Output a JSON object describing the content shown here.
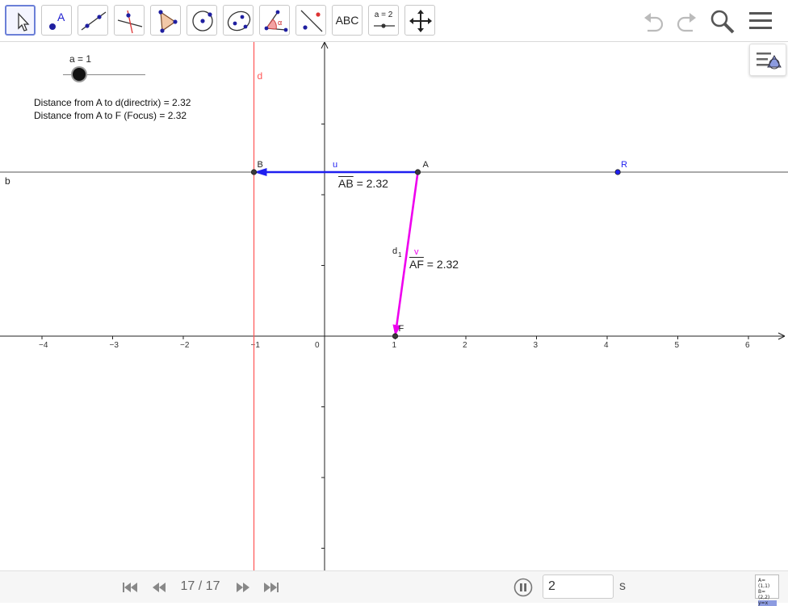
{
  "toolbar": {
    "tools": [
      {
        "name": "move-tool",
        "label": ""
      },
      {
        "name": "point-tool",
        "label": "A"
      },
      {
        "name": "line-tool",
        "label": ""
      },
      {
        "name": "perpendicular-line-tool",
        "label": ""
      },
      {
        "name": "polygon-tool",
        "label": ""
      },
      {
        "name": "circle-tool",
        "label": ""
      },
      {
        "name": "ellipse-tool",
        "label": ""
      },
      {
        "name": "angle-tool",
        "label": "α"
      },
      {
        "name": "reflect-tool",
        "label": ""
      },
      {
        "name": "text-tool",
        "label": "ABC"
      },
      {
        "name": "slider-tool",
        "label": "a = 2"
      },
      {
        "name": "move-graphics-view-tool",
        "label": ""
      }
    ],
    "right_icons": [
      "undo-icon",
      "redo-icon",
      "search-icon",
      "menu-icon"
    ]
  },
  "slider": {
    "label": "a = 1",
    "value_fraction": 0.2
  },
  "texts": {
    "distance_directrix": "Distance from A to d(directrix) = 2.32",
    "distance_focus": "Distance from A to F (Focus) = 2.32",
    "ab_value": "= 2.32",
    "ab_name": "AB",
    "af_value": "= 2.32",
    "af_name": "AF"
  },
  "labels": {
    "d": "d",
    "b": "b",
    "B": "B",
    "A": "A",
    "R": "R",
    "F": "F",
    "u": "u",
    "v": "v",
    "d1": "d",
    "d1_sub": "1"
  },
  "axes": {
    "x_ticks": [
      "−4",
      "−3",
      "−2",
      "−1",
      "0",
      "1",
      "2",
      "3",
      "4",
      "5",
      "6"
    ],
    "x_values": [
      -4,
      -3,
      -2,
      -1,
      0,
      1,
      2,
      3,
      4,
      5,
      6
    ]
  },
  "geometry": {
    "A": [
      1.32,
      2.32
    ],
    "B": [
      -1,
      2.32
    ],
    "F": [
      1,
      0
    ],
    "R": [
      4.15,
      2.32
    ],
    "directrix_x": -1
  },
  "colors": {
    "directrix": "#ff5555",
    "vector_u": "#1f1ff0",
    "vector_v": "#ee00ee",
    "point": "#3a3a3a",
    "R": "#1f1ff0"
  },
  "bottombar": {
    "page_counter": "17 / 17",
    "speed_value": "2",
    "speed_unit": "s",
    "algebra_icon_lines": [
      "A=(1,1)",
      "B=(2,2)",
      "y=x"
    ]
  }
}
